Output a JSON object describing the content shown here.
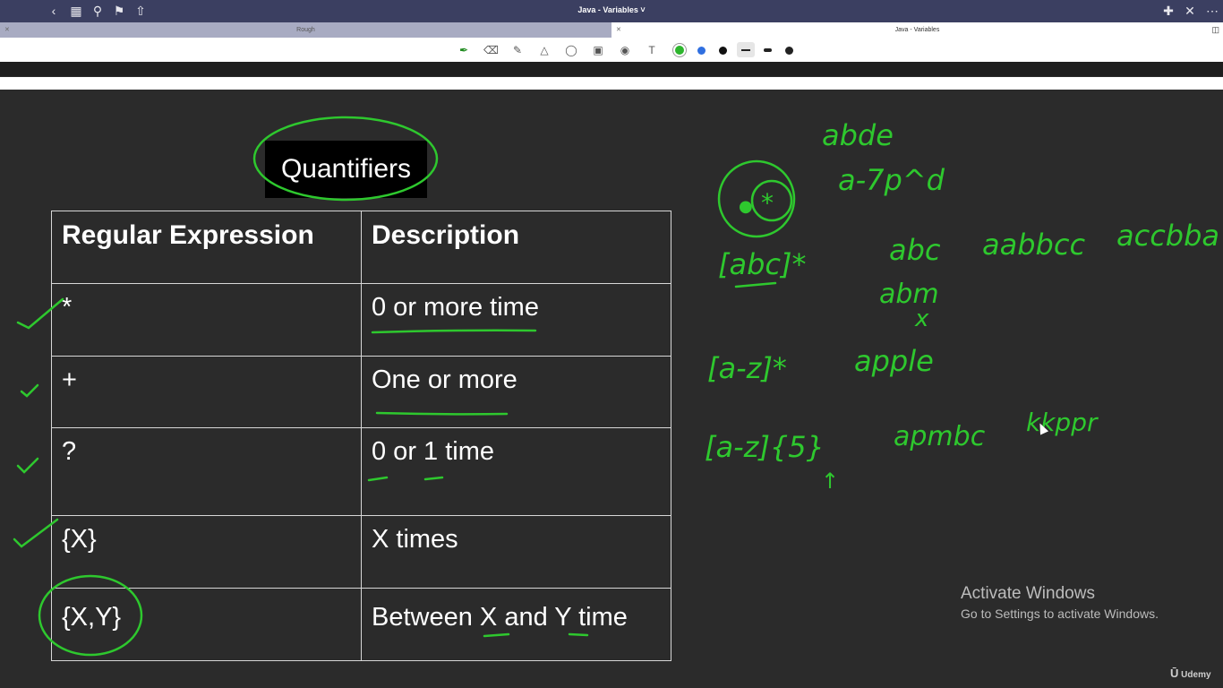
{
  "app": {
    "title": "Java - Variables"
  },
  "tabs": [
    {
      "label": "Rough",
      "active": false
    },
    {
      "label": "Java - Variables",
      "active": true
    }
  ],
  "toolbar": {
    "tools": [
      "pen-icon",
      "eraser-icon",
      "highlighter-icon",
      "shapes-icon",
      "lasso-icon",
      "image-icon",
      "camera-icon",
      "text-icon"
    ],
    "colors": [
      "#2db52d",
      "#2f6fe0",
      "#111111"
    ],
    "stroke_sizes": [
      "thin",
      "medium",
      "thick"
    ]
  },
  "slide": {
    "title": "Quantifiers",
    "headers": {
      "col1": "Regular Expression",
      "col2": "Description"
    },
    "rows": [
      {
        "regex": "*",
        "description": "0 or more time"
      },
      {
        "regex": "+",
        "description": "One or more"
      },
      {
        "regex": "?",
        "description": "0 or 1 time"
      },
      {
        "regex": "{X}",
        "description": "X times"
      },
      {
        "regex": "{X,Y}",
        "description": "Between X and Y time"
      }
    ]
  },
  "notes": {
    "line1": "abde",
    "line2": "a-7p^d",
    "ex1_regex": "[abc]*",
    "ex1_a": "abc",
    "ex1_b": "aabbcc",
    "ex1_c": "accbba",
    "ex1_d": "abm",
    "ex1_mark": "x",
    "ex2_regex": "[a-z]*",
    "ex2_a": "apple",
    "ex3_regex": "[a-z]{5}",
    "ex3_a": "apmbc",
    "ex3_b": "kkppr",
    "ex3_arrow": "↑"
  },
  "watermark": {
    "line1": "Activate Windows",
    "line2": "Go to Settings to activate Windows."
  },
  "brand": "Udemy"
}
